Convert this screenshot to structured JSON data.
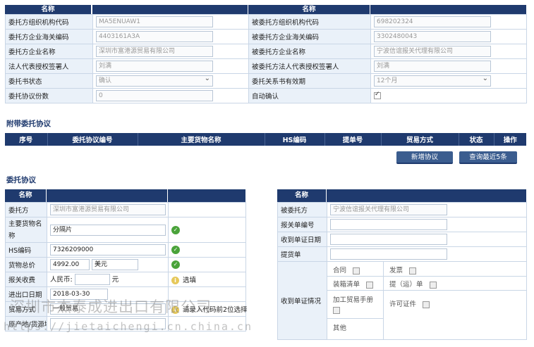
{
  "top_table": {
    "header_left": "名称",
    "header_right": "名称",
    "rows": [
      {
        "l_label": "委托方组织机构代码",
        "l_value": "MA5ENUAW1",
        "r_label": "被委托方组织机构代码",
        "r_value": "698202324"
      },
      {
        "l_label": "委托方企业海关编码",
        "l_value": "4403161A3A",
        "r_label": "被委托方企业海关编码",
        "r_value": "3302480043"
      },
      {
        "l_label": "委托方企业名称",
        "l_value": "深圳市富港源贸易有限公司",
        "r_label": "被委托方企业名称",
        "r_value": "宁波信谊报关代理有限公司"
      },
      {
        "l_label": "法人代表授权签署人",
        "l_value": "刘满",
        "r_label": "被委托方法人代表授权签署人",
        "r_value": "刘满"
      },
      {
        "l_label": "委托书状态",
        "l_value": "确认",
        "r_label": "委托关系书有效期",
        "r_value": "12个月"
      },
      {
        "l_label": "委托协议份数",
        "l_value": "0",
        "r_label": "自动确认",
        "r_value": ""
      }
    ]
  },
  "attached": {
    "title": "附带委托协议",
    "columns": [
      "序号",
      "委托协议编号",
      "主要货物名称",
      "HS编码",
      "提单号",
      "贸易方式",
      "状态",
      "操作"
    ],
    "add_button": "新增协议",
    "query_button": "查询最近5条"
  },
  "agreement": {
    "title": "委托协议",
    "left_header": "名称",
    "right_header": "名称",
    "left": {
      "client_label": "委托方",
      "client_value": "深圳市富港源贸易有限公司",
      "goods_label": "主要货物名称",
      "goods_value": "分隔片",
      "hs_label": "HS编码",
      "hs_value": "7326209000",
      "total_label": "货物总价",
      "total_value": "4992.00",
      "currency_value": "美元",
      "fee_label": "报关收费",
      "fee_currency": "人民币:",
      "fee_unit": "元",
      "fee_hint": "选填",
      "date_label": "进出口日期",
      "date_value": "2018-03-30",
      "trade_label": "贸易方式",
      "trade_value": "一般贸易",
      "trade_hint": "请录入代码前2位选择",
      "origin_label": "原产地/货源地"
    },
    "right": {
      "agent_label": "被委托方",
      "agent_value": "宁波信谊报关代理有限公司",
      "decl_label": "报关单编号",
      "recv_date_label": "收到单证日期",
      "bill_label": "提货单",
      "docs_label": "收到单证情况",
      "docs": {
        "contract": "合同",
        "invoice": "发票",
        "packing": "装箱清单",
        "bol": "提（运）单",
        "manual": "加工贸易手册",
        "license": "许可证件",
        "other": "其他"
      }
    }
  },
  "watermark": {
    "text1": "深圳市杰泰成进出口有限公司",
    "text2": "https://jietaichengi.cn.china.cn"
  }
}
